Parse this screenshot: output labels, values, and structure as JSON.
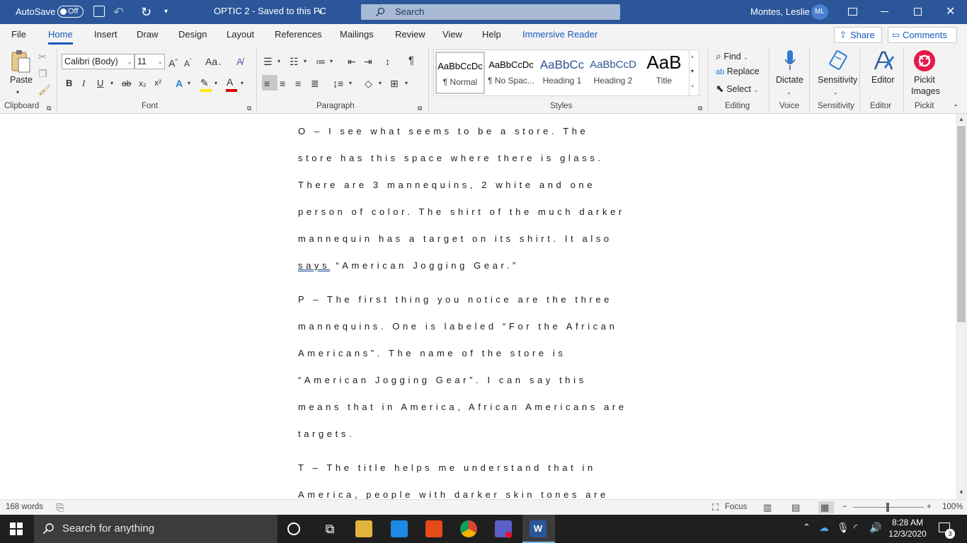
{
  "titlebar": {
    "autosave_label": "AutoSave",
    "autosave_state": "Off",
    "doc_title": "OPTIC 2  -  Saved to this PC",
    "search_placeholder": "Search",
    "user_name": "Montes, Leslie",
    "user_initials": "ML",
    "accent_color": "#2b579a"
  },
  "menu": {
    "tabs": [
      "File",
      "Home",
      "Insert",
      "Draw",
      "Design",
      "Layout",
      "References",
      "Mailings",
      "Review",
      "View",
      "Help",
      "Immersive Reader"
    ],
    "active_tab": "Home",
    "share_label": "Share",
    "comments_label": "Comments"
  },
  "ribbon": {
    "clipboard": {
      "paste_label": "Paste",
      "group_label": "Clipboard"
    },
    "font": {
      "font_name": "Calibri (Body)",
      "font_size": "11",
      "group_label": "Font",
      "change_case": "Aa",
      "bold": "B",
      "italic": "I",
      "underline": "U",
      "strike": "ab",
      "sub": "x₂",
      "sup": "x²"
    },
    "paragraph": {
      "group_label": "Paragraph",
      "pilcrow": "¶"
    },
    "styles": {
      "group_label": "Styles",
      "items": [
        {
          "preview": "AaBbCcDc",
          "name": "¶ Normal"
        },
        {
          "preview": "AaBbCcDc",
          "name": "¶ No Spac..."
        },
        {
          "preview": "AaBbCc",
          "name": "Heading 1"
        },
        {
          "preview": "AaBbCcD",
          "name": "Heading 2"
        },
        {
          "preview": "AaB",
          "name": "Title"
        }
      ]
    },
    "editing": {
      "find": "Find",
      "replace": "Replace",
      "select": "Select",
      "group_label": "Editing"
    },
    "voice": {
      "dictate": "Dictate",
      "group_label": "Voice"
    },
    "sensitivity": {
      "label": "Sensitivity",
      "group_label": "Sensitivity"
    },
    "editor": {
      "label": "Editor",
      "group_label": "Editor"
    },
    "pickit": {
      "label1": "Pickit",
      "label2": "Images",
      "group_label": "Pickit"
    }
  },
  "document": {
    "paragraphs": [
      [
        "O – I see what seems to be a store. The",
        "store has this space where there is glass.",
        "There are 3 mannequins, 2 white and one",
        "person of color. The shirt of the much darker",
        "mannequin has a target on its shirt. It also"
      ],
      [
        "P – The first thing you notice are the three",
        "mannequins. One is labeled “For the African",
        "Americans”. The name of the store is",
        "“American Jogging Gear”. I can say this",
        "means that in America, African Americans are",
        "targets."
      ],
      [
        "T – The title helps me understand that in",
        "America, people with darker skin tones are"
      ]
    ],
    "line_says_word": "says",
    "line_says_rest": " “American Jogging Gear.”"
  },
  "statusbar": {
    "word_count": "168 words",
    "focus": "Focus",
    "zoom": "100%"
  },
  "taskbar": {
    "search_placeholder": "Search for anything",
    "time": "8:28 AM",
    "date": "12/3/2020",
    "notifications": "3"
  }
}
